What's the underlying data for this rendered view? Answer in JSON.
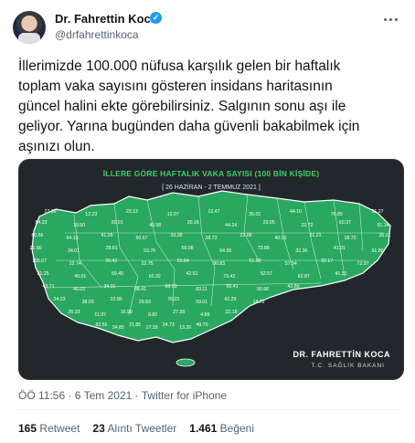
{
  "tweet": {
    "author_name": "Dr. Fahrettin Koca",
    "verified_badge": "✓",
    "handle": "@drfahrettinkoca",
    "text": "İllerimizde 100.000 nüfusa karşılık gelen bir haftalık\ntoplam vaka sayısını gösteren insidans haritasının\ngüncel halini ekte görebilirsiniz. Salgının sonu aşı ile\ngeliyor. Yarına bugünden daha güvenli bakabilmek için\naşınızı olun.",
    "timestamp": "ÖÖ 11:56 · 6 Tem 2021 · Twitter for iPhone",
    "retweets": {
      "count": "165",
      "label": "Retweet"
    },
    "quotes": {
      "count": "23",
      "label": "Alıntı Tweetler"
    },
    "likes": {
      "count": "1.461",
      "label": "Beğeni"
    }
  },
  "media": {
    "title": "İLLERE GÖRE HAFTALIK VAKA SAYISI (100 BİN KİŞİDE)",
    "date_range": "[ 26 HAZİRAN - 2 TEMMUZ 2021 ]",
    "signature": "DR. FAHRETTİN KOCA",
    "signature_sub": "T.C. SAĞLIK BAKANI",
    "colors": {
      "background": "#22272c",
      "region": "#2aa860",
      "border": "#ffffff"
    },
    "province_values": [
      "27.38",
      "12.23",
      "23.12",
      "12.07",
      "12.47",
      "35.01",
      "44.10",
      "76.85",
      "31.27",
      "84.23",
      "19.50",
      "20.01",
      "45.98",
      "20.16",
      "44.24",
      "23.05",
      "22.72",
      "60.37",
      "91.14",
      "80.66",
      "64.13",
      "41.55",
      "50.67",
      "33.38",
      "28.73",
      "23.08",
      "40.01",
      "21.21",
      "18.72",
      "35.21",
      "21.90",
      "34.01",
      "28.81",
      "53.76",
      "66.08",
      "64.95",
      "73.88",
      "32.36",
      "41.01",
      "91.80",
      "155.57",
      "22.74",
      "26.42",
      "22.75",
      "55.84",
      "90.83",
      "51.90",
      "57.54",
      "32.17",
      "72.97",
      "31.25",
      "49.01",
      "59.45",
      "60.32",
      "42.61",
      "73.42",
      "52.57",
      "62.87",
      "41.31",
      "43.71",
      "46.03",
      "34.01",
      "88.41",
      "68.53",
      "83.11",
      "65.41",
      "90.98",
      "42.80",
      "24.23",
      "38.03",
      "22.86",
      "29.83",
      "76.03",
      "59.01",
      "42.29",
      "14.72",
      "26.33",
      "11.97",
      "16.99",
      "8.82",
      "27.28",
      "4.88",
      "22.18",
      "62.56",
      "34.85",
      "21.85",
      "17.39",
      "24.73",
      "13.26",
      "49.79"
    ]
  }
}
